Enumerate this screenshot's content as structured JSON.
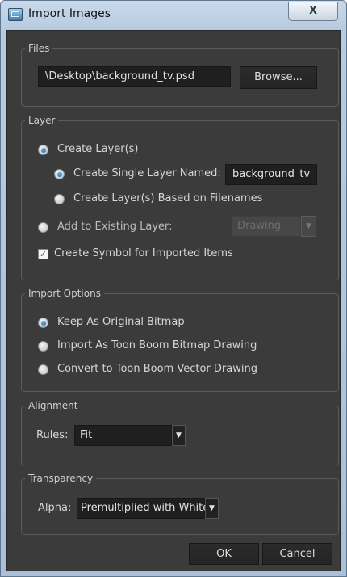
{
  "window": {
    "title": "Import Images",
    "close_label": "X"
  },
  "files": {
    "group_title": "Files",
    "path_value": "\\Desktop\\background_tv.psd",
    "browse_label": "Browse..."
  },
  "layer": {
    "group_title": "Layer",
    "create_layers_label": "Create Layer(s)",
    "create_single_label": "Create Single Layer Named:",
    "single_layer_name": "background_tv",
    "based_on_filenames_label": "Create Layer(s) Based on Filenames",
    "add_existing_label": "Add to Existing Layer:",
    "existing_layer_value": "Drawing",
    "create_symbol_label": "Create Symbol for Imported Items",
    "create_layers_selected": true,
    "create_single_selected": true,
    "create_symbol_checked": true
  },
  "import_options": {
    "group_title": "Import Options",
    "options": [
      {
        "label": "Keep As Original Bitmap",
        "selected": true
      },
      {
        "label": "Import As Toon Boom Bitmap Drawing",
        "selected": false
      },
      {
        "label": "Convert to Toon Boom Vector Drawing",
        "selected": false
      }
    ]
  },
  "alignment": {
    "group_title": "Alignment",
    "rules_label": "Rules:",
    "rules_value": "Fit"
  },
  "transparency": {
    "group_title": "Transparency",
    "alpha_label": "Alpha:",
    "alpha_value": "Premultiplied with White"
  },
  "footer": {
    "ok_label": "OK",
    "cancel_label": "Cancel"
  },
  "colors": {
    "dialog_bg": "#3b3b3b",
    "field_bg": "#1f1f1f",
    "radio_accent": "#1b5fa0"
  }
}
